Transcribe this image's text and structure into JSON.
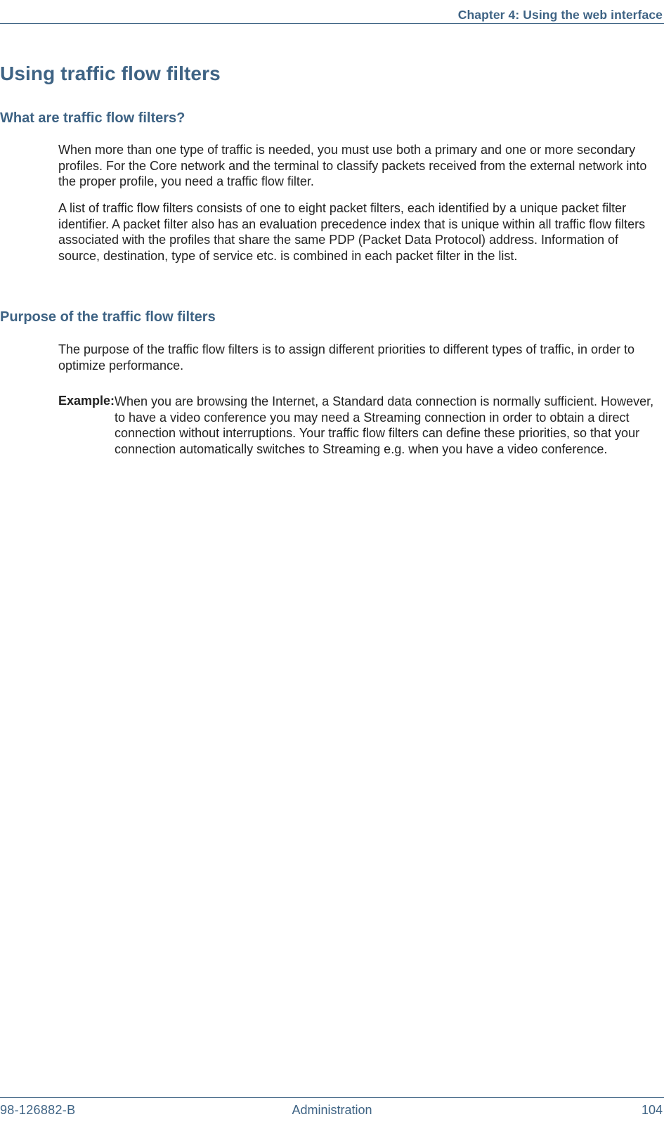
{
  "header": {
    "chapter": "Chapter 4: Using the web interface"
  },
  "headings": {
    "h1": "Using traffic flow filters",
    "h2a": "What are traffic flow filters?",
    "h2b": "Purpose of the traffic flow filters"
  },
  "body": {
    "para1": "When more than one type of traffic is needed, you must use both a primary and one or more secondary profiles. For the Core network and the terminal to classify packets received from the external network into the proper profile, you need a traffic flow filter.",
    "para2": "A list of traffic flow filters consists of one to eight packet filters, each identified by a unique packet filter identifier. A packet filter also has an evaluation precedence index that is unique within all traffic flow filters associated with the profiles that share the same PDP (Packet Data Protocol) address. Information of source, destination, type of service etc. is combined in each packet filter in the list.",
    "para3": "The purpose of the traffic flow filters is to assign different priorities to different types of traffic, in order to optimize performance.",
    "example_label": "Example:",
    "example_body": "When you are browsing the Internet, a Standard data connection is normally sufficient. However, to have a video conference you may need a Streaming connection in order to obtain a direct connection without interruptions. Your traffic flow filters can define these priorities, so that your connection automatically switches to Streaming e.g. when you have a video conference."
  },
  "footer": {
    "doc_number": "98-126882-B",
    "section": "Administration",
    "page": "104"
  }
}
